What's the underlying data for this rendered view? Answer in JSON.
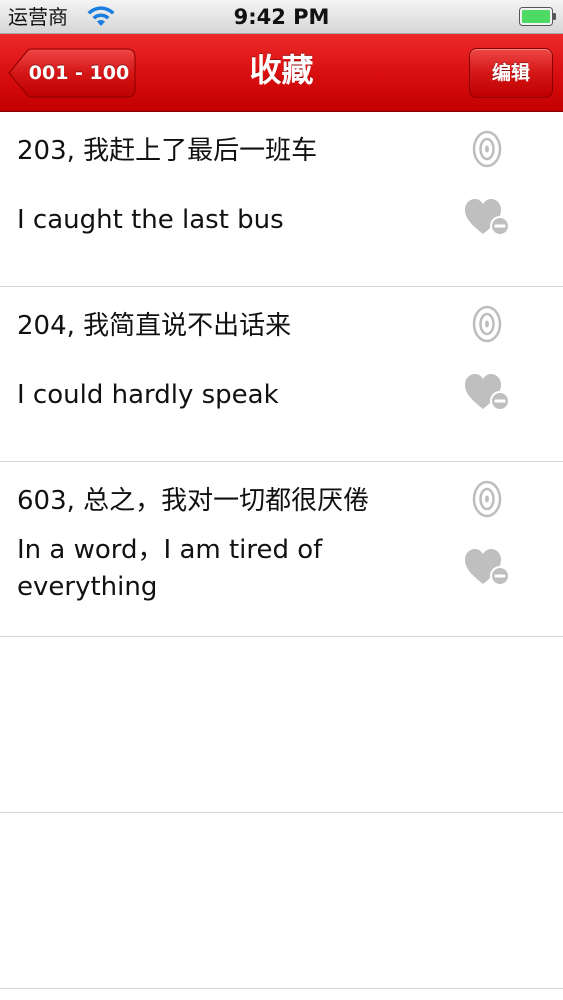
{
  "status_bar": {
    "carrier": "运营商",
    "time": "9:42 PM",
    "wifi_icon": "wifi-icon",
    "battery_icon": "battery-icon",
    "battery_color": "#4cd964"
  },
  "nav": {
    "title": "收藏",
    "back_label": "001 - 100",
    "edit_label": "编辑",
    "bar_color": "#d90f10"
  },
  "favorites": [
    {
      "cn": "203, 我赶上了最后一班车",
      "en": "I caught the last bus",
      "speaker_icon": "speaker-icon",
      "remove_icon": "heart-minus-icon"
    },
    {
      "cn": "204, 我简直说不出话来",
      "en": "I could hardly speak",
      "speaker_icon": "speaker-icon",
      "remove_icon": "heart-minus-icon"
    },
    {
      "cn": "603, 总之，我对一切都很厌倦",
      "en": "In a word，I am tired of everything",
      "speaker_icon": "speaker-icon",
      "remove_icon": "heart-minus-icon"
    }
  ]
}
